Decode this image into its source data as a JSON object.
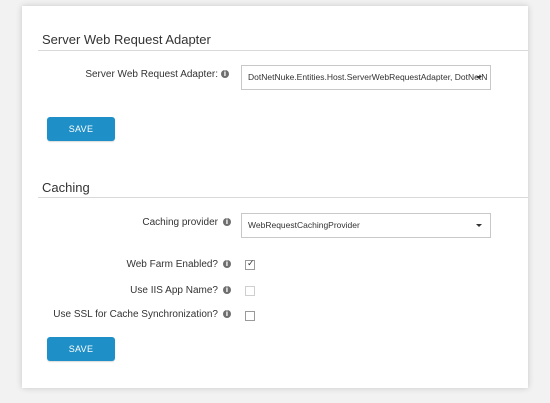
{
  "server_section": {
    "title": "Server Web Request Adapter",
    "adapter_label": "Server Web Request Adapter:",
    "adapter_value": "DotNetNuke.Entities.Host.ServerWebRequestAdapter, DotNetN",
    "save_label": "SAVE"
  },
  "caching_section": {
    "title": "Caching",
    "provider_label": "Caching provider",
    "provider_value": "WebRequestCachingProvider",
    "web_farm_label": "Web Farm Enabled?",
    "web_farm_checked": true,
    "iis_app_name_label": "Use IIS App Name?",
    "iis_app_name_checked": false,
    "ssl_label": "Use SSL for Cache Synchronization?",
    "ssl_checked": false,
    "save_label": "SAVE"
  },
  "icons": {
    "info": "info-icon",
    "check": "✓",
    "dropdown": "chevron-down-icon"
  },
  "colors": {
    "primary_button": "#1e8fc7"
  }
}
